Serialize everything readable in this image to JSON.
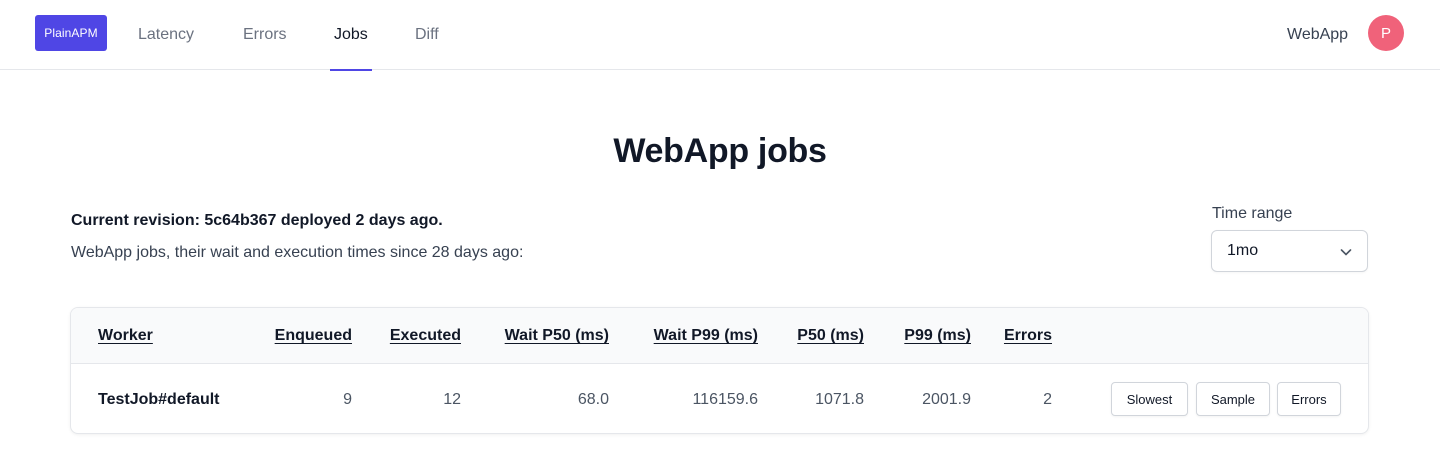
{
  "header": {
    "logo_text": "PlainAPM",
    "nav": [
      {
        "label": "Latency",
        "active": false
      },
      {
        "label": "Errors",
        "active": false
      },
      {
        "label": "Jobs",
        "active": true
      },
      {
        "label": "Diff",
        "active": false
      }
    ],
    "app_name": "WebApp",
    "avatar_initial": "P",
    "avatar_color": "#f0627a",
    "accent_color": "#4f46e5"
  },
  "main": {
    "title": "WebApp jobs",
    "revision_text": "Current revision: 5c64b367 deployed 2 days ago.",
    "subtitle": "WebApp jobs, their wait and execution times since 28 days ago:",
    "time_range": {
      "label": "Time range",
      "selected": "1mo",
      "icon": "chevron-down-icon"
    }
  },
  "table": {
    "columns": [
      "Worker",
      "Enqueued",
      "Executed",
      "Wait P50 (ms)",
      "Wait P99 (ms)",
      "P50 (ms)",
      "P99 (ms)",
      "Errors"
    ],
    "rows": [
      {
        "worker": "TestJob#default",
        "enqueued": "9",
        "executed": "12",
        "wait_p50": "68.0",
        "wait_p99": "116159.6",
        "p50": "1071.8",
        "p99": "2001.9",
        "errors": "2",
        "actions": [
          "Slowest",
          "Sample",
          "Errors"
        ]
      }
    ]
  }
}
